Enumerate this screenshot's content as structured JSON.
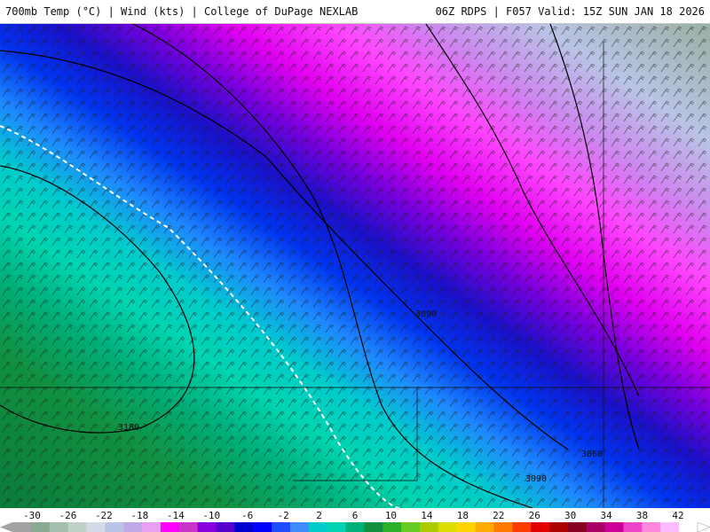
{
  "header": {
    "left_title": "700mb Temp (°C) | Wind (kts) | College of DuPage NEXLAB",
    "right_title": "06Z RDPS | F057 Valid: 15Z SUN JAN 18 2026"
  },
  "colorbar": {
    "labels": [
      "-30",
      "-26",
      "-22",
      "-18",
      "-14",
      "-10",
      "-6",
      "-2",
      "2",
      "6",
      "10",
      "14",
      "18",
      "22",
      "26",
      "30",
      "34",
      "38",
      "42"
    ],
    "colors": [
      "#a3a3a3",
      "#8aaa92",
      "#a5bfae",
      "#c0d2c7",
      "#d3dce6",
      "#b9c4e6",
      "#c1a9e8",
      "#e8a0f2",
      "#ff00ff",
      "#cc33cc",
      "#8800dd",
      "#5500cc",
      "#0000cc",
      "#0000ff",
      "#1e4fff",
      "#3f8dff",
      "#00cccc",
      "#00d4b0",
      "#00b07a",
      "#119040",
      "#2bb02b",
      "#66cc22",
      "#aacc00",
      "#dddd00",
      "#ffd400",
      "#ffaa00",
      "#ff7a00",
      "#ff3c00",
      "#e00000",
      "#aa0000",
      "#880022",
      "#aa0066",
      "#cc0099",
      "#ee44cc",
      "#ff88dd",
      "#ffbbff",
      "#ffffff"
    ]
  },
  "contours": {
    "labels": [
      "3090",
      "3180",
      "3060",
      "3090"
    ]
  }
}
